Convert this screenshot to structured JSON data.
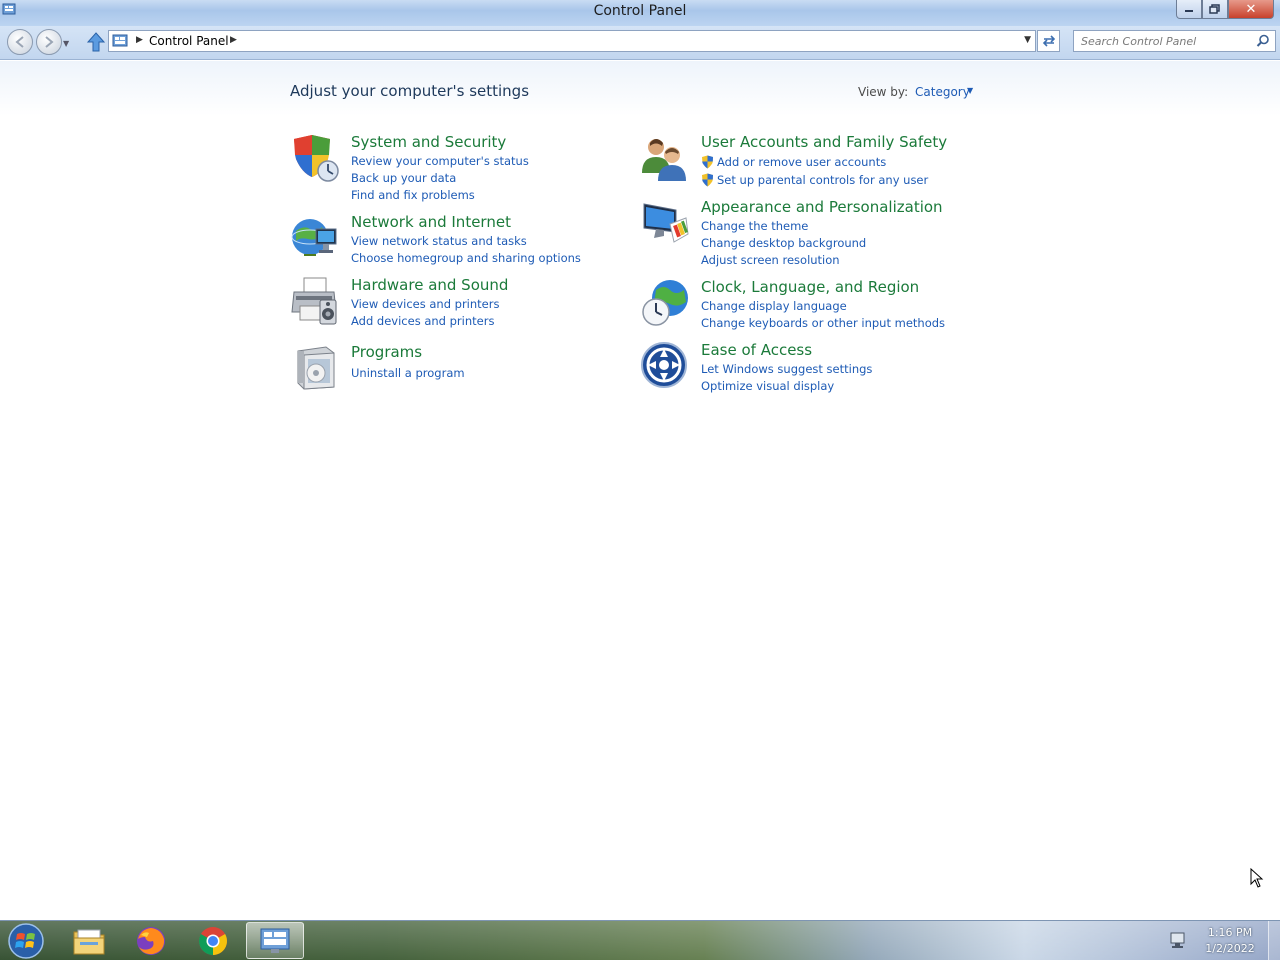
{
  "window": {
    "title": "Control Panel",
    "icon": "control-panel-icon",
    "controls": [
      "minimize-icon",
      "restore-icon",
      "close-icon"
    ]
  },
  "navbar": {
    "breadcrumb": "Control Panel",
    "search_placeholder": "Search Control Panel"
  },
  "main": {
    "heading": "Adjust your computer's settings",
    "view_by_label": "View by:",
    "view_by_value": "Category",
    "categories": [
      {
        "title": "System and Security",
        "icon": "shield-security-icon",
        "links": [
          "Review your computer's status",
          "Back up your data",
          "Find and fix problems"
        ]
      },
      {
        "title": "Network and Internet",
        "icon": "network-globe-icon",
        "links": [
          "View network status and tasks",
          "Choose homegroup and sharing options"
        ]
      },
      {
        "title": "Hardware and Sound",
        "icon": "printer-speaker-icon",
        "links": [
          "View devices and printers",
          "Add devices and printers"
        ]
      },
      {
        "title": "Programs",
        "icon": "programs-box-icon",
        "links": [
          "Uninstall a program"
        ]
      },
      {
        "title": "User Accounts and Family Safety",
        "icon": "users-icon",
        "links": [
          "Add or remove user accounts",
          "Set up parental controls for any user"
        ]
      },
      {
        "title": "Appearance and Personalization",
        "icon": "monitor-palette-icon",
        "links": [
          "Change the theme",
          "Change desktop background",
          "Adjust screen resolution"
        ]
      },
      {
        "title": "Clock, Language, and Region",
        "icon": "clock-globe-icon",
        "links": [
          "Change display language",
          "Change keyboards or other input methods"
        ]
      },
      {
        "title": "Ease of Access",
        "icon": "ease-of-access-icon",
        "links": [
          "Let Windows suggest settings",
          "Optimize visual display"
        ]
      }
    ]
  },
  "taskbar": {
    "items": [
      "start-orb-icon",
      "file-explorer-icon",
      "firefox-icon",
      "chrome-icon",
      "control-panel-icon"
    ],
    "active": "control-panel-icon",
    "time": "1:16 PM",
    "date": "1/2/2022"
  },
  "colors": {
    "category_title": "#1b7a3a",
    "link": "#1e5bb5",
    "heading": "#1e395b"
  }
}
